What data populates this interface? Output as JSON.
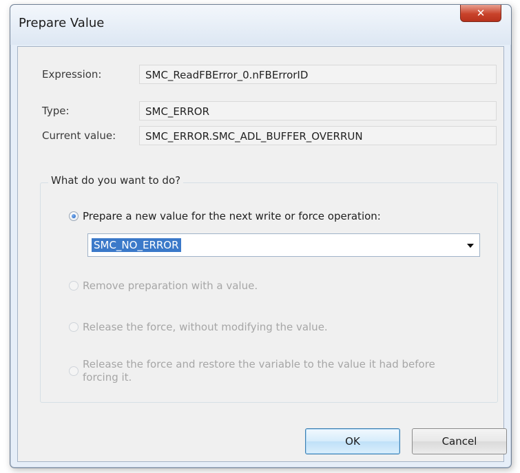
{
  "window": {
    "title": "Prepare Value",
    "close_glyph": "✕"
  },
  "info": {
    "expression_label": "Expression:",
    "expression_value": "SMC_ReadFBError_0.nFBErrorID",
    "type_label": "Type:",
    "type_value": "SMC_ERROR",
    "current_label": "Current value:",
    "current_value": "SMC_ERROR.SMC_ADL_BUFFER_OVERRUN"
  },
  "group": {
    "caption": "What do you want to do?",
    "options": [
      {
        "label": "Prepare a new value for the next write or force operation:",
        "selected": true,
        "enabled": true
      },
      {
        "label": "Remove preparation with a value.",
        "selected": false,
        "enabled": false
      },
      {
        "label": "Release the force, without modifying the value.",
        "selected": false,
        "enabled": false
      },
      {
        "label": "Release the force and restore the variable to the value it had before forcing it.",
        "selected": false,
        "enabled": false
      }
    ],
    "combo_value": "SMC_NO_ERROR"
  },
  "buttons": {
    "ok": "OK",
    "cancel": "Cancel"
  },
  "colors": {
    "window_bg": "#e6eef8",
    "client_bg": "#f0f0f0",
    "selection": "#3b79c9",
    "close_button": "#c9432b"
  }
}
